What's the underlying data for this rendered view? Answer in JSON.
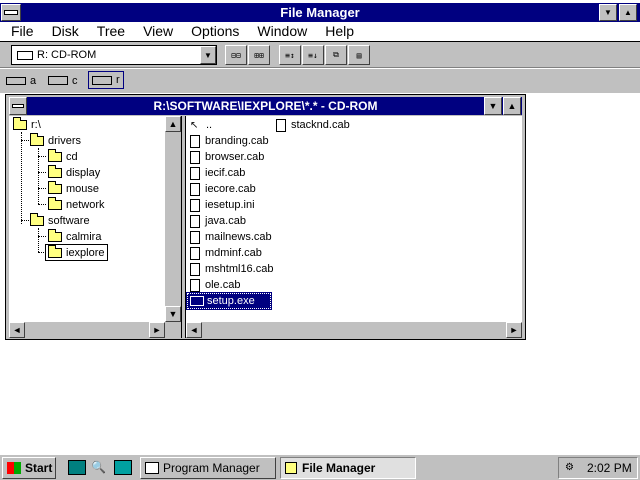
{
  "main_window": {
    "title": "File Manager",
    "menu": [
      "File",
      "Disk",
      "Tree",
      "View",
      "Options",
      "Window",
      "Help"
    ]
  },
  "toolbar": {
    "drive_select": "R: CD-ROM",
    "buttons": [
      "tree-view",
      "tree-dir-view",
      "dir-only-view",
      "list-view",
      "details-view",
      "new-window",
      "properties"
    ]
  },
  "drive_bar": {
    "drives": [
      {
        "letter": "a",
        "type": "floppy"
      },
      {
        "letter": "c",
        "type": "hard-disk"
      },
      {
        "letter": "r",
        "type": "cd-rom",
        "selected": true
      }
    ]
  },
  "child_window": {
    "title": "R:\\SOFTWARE\\IEXPLORE\\*.* - CD-ROM",
    "tree": [
      {
        "label": "r:\\",
        "level": 0
      },
      {
        "label": "drivers",
        "level": 1
      },
      {
        "label": "cd",
        "level": 2
      },
      {
        "label": "display",
        "level": 2
      },
      {
        "label": "mouse",
        "level": 2
      },
      {
        "label": "network",
        "level": 2
      },
      {
        "label": "software",
        "level": 1
      },
      {
        "label": "calmira",
        "level": 2
      },
      {
        "label": "iexplore",
        "level": 2,
        "selected": true
      }
    ],
    "files_col1": [
      {
        "name": "..",
        "type": "up"
      },
      {
        "name": "branding.cab",
        "type": "file"
      },
      {
        "name": "browser.cab",
        "type": "file"
      },
      {
        "name": "iecif.cab",
        "type": "file"
      },
      {
        "name": "iecore.cab",
        "type": "file"
      },
      {
        "name": "iesetup.ini",
        "type": "file"
      },
      {
        "name": "java.cab",
        "type": "file"
      },
      {
        "name": "mailnews.cab",
        "type": "file"
      },
      {
        "name": "mdminf.cab",
        "type": "file"
      },
      {
        "name": "mshtml16.cab",
        "type": "file"
      },
      {
        "name": "ole.cab",
        "type": "file"
      },
      {
        "name": "setup.exe",
        "type": "exe",
        "selected": true
      }
    ],
    "files_col2": [
      {
        "name": "stacknd.cab",
        "type": "file"
      }
    ]
  },
  "taskbar": {
    "start_label": "Start",
    "quick_launch": [
      "desktop-icon",
      "find-icon",
      "disk-icon"
    ],
    "tasks": [
      {
        "label": "Program Manager",
        "active": false
      },
      {
        "label": "File Manager",
        "active": true
      }
    ],
    "clock": "2:02 PM"
  }
}
